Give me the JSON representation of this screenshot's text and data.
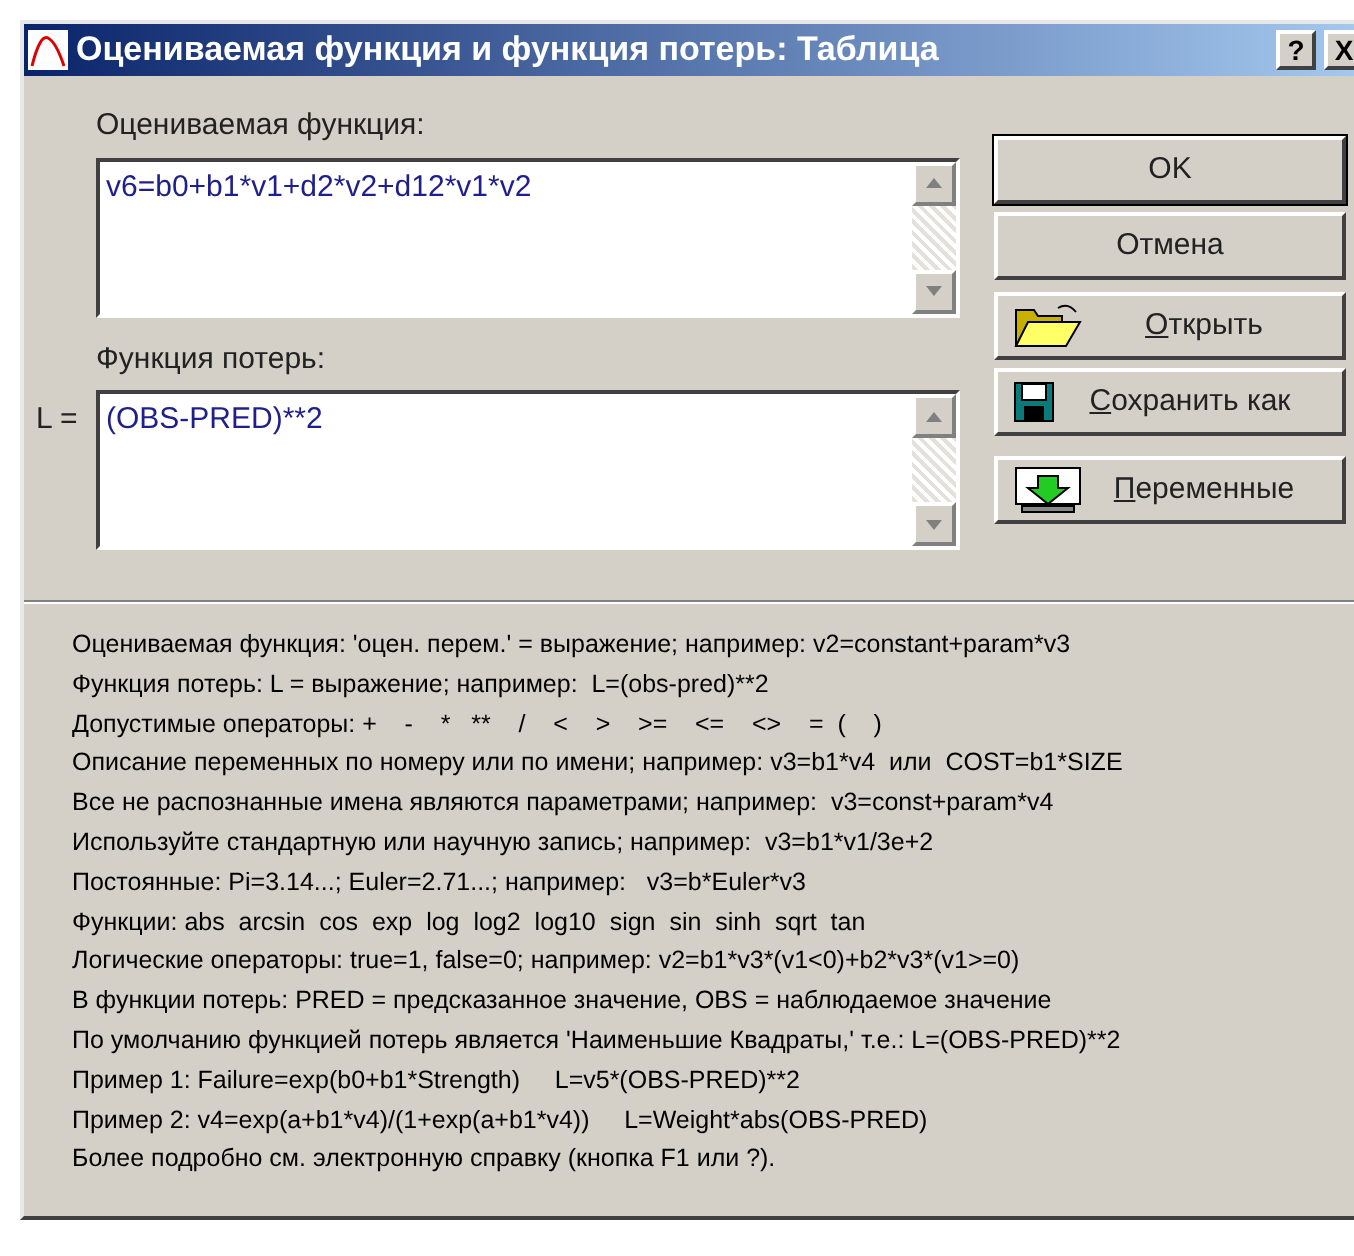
{
  "window": {
    "title": "Оцениваемая функция и функция потерь: Таблица",
    "help_button": "?",
    "close_button": "X"
  },
  "function_field": {
    "label": "Оцениваемая функция:",
    "value": "v6=b0+b1*v1+d2*v2+d12*v1*v2"
  },
  "loss_field": {
    "label": "Функция потерь:",
    "prefix": "L =",
    "value": "(OBS-PRED)**2"
  },
  "buttons": [
    {
      "kind": "text",
      "rest": "OK",
      "default": true
    },
    {
      "kind": "text",
      "rest": "Отмена",
      "default": false
    },
    {
      "kind": "open",
      "accel": "О",
      "rest": "ткрыть",
      "default": false
    },
    {
      "kind": "save",
      "accel": "С",
      "rest": "охранить как",
      "default": false
    },
    {
      "kind": "variables",
      "accel": "П",
      "rest": "еременные",
      "default": false
    }
  ],
  "help_lines": [
    "Оцениваемая функция: 'оцен. перем.' = выражение; например: v2=constant+param*v3",
    "Функция потерь: L = выражение; например:  L=(obs-pred)**2",
    "Допустимые операторы: +    -    *   **    /    <    >    >=    <=    <>    =  (    )",
    "Описание переменных по номеру или по имени; например: v3=b1*v4  или  COST=b1*SIZE",
    "Все не распознанные имена являются параметрами; например:  v3=const+param*v4",
    "Используйте стандартную или научную запись; например:  v3=b1*v1/3e+2",
    "Постоянные: Pi=3.14...; Euler=2.71...; например:   v3=b*Euler*v3",
    "Функции: abs  arcsin  cos  exp  log  log2  log10  sign  sin  sinh  sqrt  tan",
    "Логические операторы: true=1, false=0; например: v2=b1*v3*(v1<0)+b2*v3*(v1>=0)",
    "В функции потерь: PRED = предсказанное значение, OBS = наблюдаемое значение",
    "По умолчанию функцией потерь является 'Наименьшие Квадраты,' т.е.: L=(OBS-PRED)**2",
    "Пример 1: Failure=exp(b0+b1*Strength)     L=v5*(OBS-PRED)**2",
    "Пример 2: v4=exp(a+b1*v4)/(1+exp(a+b1*v4))     L=Weight*abs(OBS-PRED)",
    "Более подробно см. электронную справку (кнопка F1 или ?)."
  ]
}
